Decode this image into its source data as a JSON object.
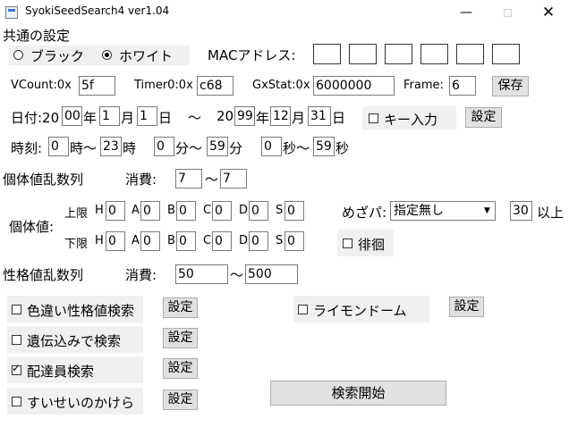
{
  "window": {
    "title": "SyokiSeedSearch4 ver1.04",
    "minimize": "—",
    "close": "✕"
  },
  "common": {
    "heading": "共通の設定",
    "radio_black": "ブラック",
    "radio_white": "ホワイト",
    "mac_label": "MACアドレス:",
    "mac": [
      "",
      "",
      "",
      "",
      "",
      ""
    ],
    "vcount_label": "VCount:0x",
    "vcount": "5f",
    "timer0_label": "Timer0:0x",
    "timer0": "c68",
    "gxstat_label": "GxStat:0x",
    "gxstat": "6000000",
    "frame_label": "Frame:",
    "frame": "6",
    "save_button": "保存"
  },
  "date": {
    "label": "日付:20",
    "from_year": "00",
    "year": "年",
    "from_month": "1",
    "month": "月",
    "from_day": "1",
    "day": "日",
    "tilde": "～",
    "to_prefix": "20",
    "to_year": "99",
    "to_month": "12",
    "to_day": "31",
    "key_input": "キー入力",
    "settings_button": "設定"
  },
  "time": {
    "label": "時刻:",
    "hour_from": "0",
    "hour": "時～",
    "hour_to": "23",
    "hour_end": "時",
    "min_from": "0",
    "minute": "分～",
    "min_to": "59",
    "min_end": "分",
    "sec_from": "0",
    "second": "秒～",
    "sec_to": "59",
    "sec_end": "秒"
  },
  "iv_rng": {
    "label": "個体値乱数列",
    "consume_label": "消費:",
    "from": "7",
    "tilde": "～",
    "to": "7"
  },
  "iv": {
    "label": "個体値:",
    "upper_label": "上限",
    "lower_label": "下限",
    "stat_labels": [
      "H",
      "A",
      "B",
      "C",
      "D",
      "S"
    ],
    "upper": [
      "0",
      "0",
      "0",
      "0",
      "0",
      "0"
    ],
    "lower": [
      "0",
      "0",
      "0",
      "0",
      "0",
      "0"
    ],
    "mezapa_label": "めざパ:",
    "mezapa_value": "指定無し",
    "mezapa_arrow": "▼",
    "power": "30",
    "power_suffix": "以上",
    "wander": "徘徊"
  },
  "pid_rng": {
    "label": "性格値乱数列",
    "consume_label": "消費:",
    "from": "50",
    "tilde": "～",
    "to": "500"
  },
  "options": {
    "shiny": "色違い性格値検索",
    "inherit": "遺伝込みで検索",
    "deliveryman": "配達員検索",
    "sui": "すいせいのかけら",
    "raimon": "ライモンドーム",
    "settings": "設定",
    "search_button": "検索開始"
  }
}
